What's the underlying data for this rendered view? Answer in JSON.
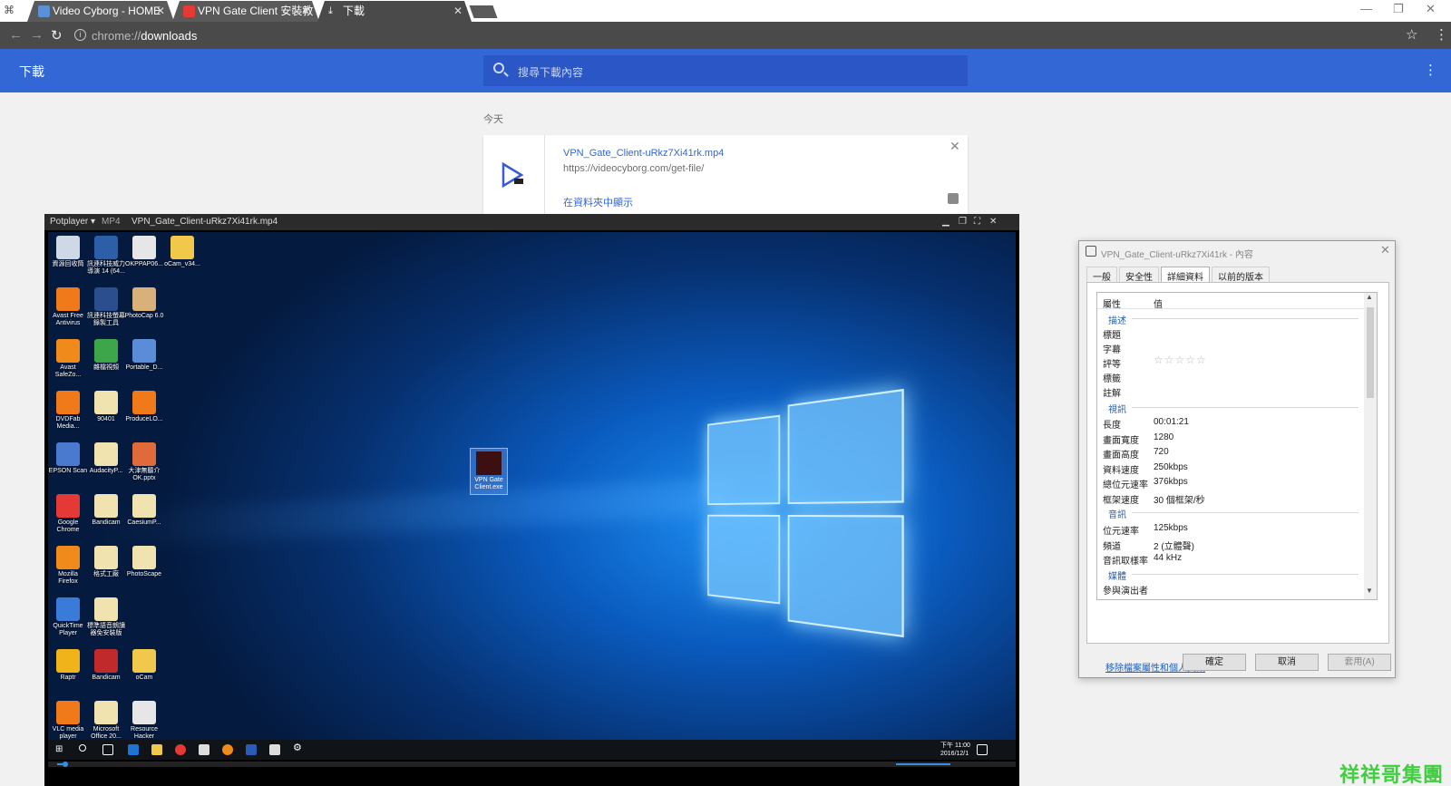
{
  "browser": {
    "tabs": [
      {
        "title": "Video Cyborg - HOME",
        "icon": "site-favicon",
        "icon_color": "#5b8fd6"
      },
      {
        "title": "VPN Gate Client 安裝教",
        "icon": "youtube-favicon",
        "icon_color": "#e53935"
      },
      {
        "title": "下載",
        "icon": "download-icon",
        "icon_color": "#ffffff"
      }
    ],
    "url_scheme": "chrome://",
    "url_path": "downloads"
  },
  "downloads": {
    "title": "下載",
    "search_placeholder": "搜尋下載內容",
    "group_label": "今天",
    "items": [
      {
        "filename": "VPN_Gate_Client-uRkz7Xi41rk.mp4",
        "source_url": "https://videocyborg.com/get-file/",
        "action": "在資料夾中顯示"
      }
    ]
  },
  "player": {
    "app": "Potplayer ▾",
    "format": "MP4",
    "file": "VPN_Gate_Client-uRkz7Xi41rk.mp4",
    "clock_time": "下午 11:00",
    "clock_date": "2016/12/1",
    "desktop_icons": [
      {
        "label": "資源回收筒",
        "color": "#cfd8e6"
      },
      {
        "label": "訊連科技威力導演 14 (64...",
        "color": "#2d5fa8"
      },
      {
        "label": "OKPPAP06...",
        "color": "#e6e6e6"
      },
      {
        "label": "oCam_v34...",
        "color": "#f2c84b"
      },
      {
        "label": "Avast Free Antivirus",
        "color": "#f07a1a"
      },
      {
        "label": "訊連科技螢幕錄製工具",
        "color": "#2b4e8e"
      },
      {
        "label": "PhotoCap 6.0",
        "color": "#d8b07a"
      },
      {
        "label": "Avast SafeZo...",
        "color": "#f08a1a"
      },
      {
        "label": "雜檔視頻",
        "color": "#3ea64a"
      },
      {
        "label": "Portable_D...",
        "color": "#5a8cd8"
      },
      {
        "label": "DVDFab Media...",
        "color": "#f07a1a"
      },
      {
        "label": "90401",
        "color": "#f1e3b0"
      },
      {
        "label": "ProduceLO...",
        "color": "#f07a1a"
      },
      {
        "label": "EPSON Scan",
        "color": "#4a7ad0"
      },
      {
        "label": "AudacityP...",
        "color": "#f1e3b0"
      },
      {
        "label": "大津無聽介OK.pptx",
        "color": "#e06a3a"
      },
      {
        "label": "Google Chrome",
        "color": "#e53935"
      },
      {
        "label": "Bandicam",
        "color": "#f1e3b0"
      },
      {
        "label": "CaesiumP...",
        "color": "#f1e3b0"
      },
      {
        "label": "Mozilla Firefox",
        "color": "#f08a1a"
      },
      {
        "label": "格式工廠",
        "color": "#f1e3b0"
      },
      {
        "label": "PhotoScape",
        "color": "#f1e3b0"
      },
      {
        "label": "QuickTime Player",
        "color": "#3a7ad8"
      },
      {
        "label": "標準語音朗讀器免安裝版",
        "color": "#f1e3b0"
      },
      {
        "label": "Raptr",
        "color": "#f0b41a"
      },
      {
        "label": "Bandicam",
        "color": "#c02a2a"
      },
      {
        "label": "oCam",
        "color": "#f0c84b"
      },
      {
        "label": "VLC media player",
        "color": "#f07a1a"
      },
      {
        "label": "Microsoft Office 20...",
        "color": "#f1e3b0"
      },
      {
        "label": "Resource Hacker",
        "color": "#e6e6e6"
      }
    ],
    "selected_file_label": "VPN Gate Client.exe"
  },
  "properties": {
    "title": "VPN_Gate_Client-uRkz7Xi41rk - 內容",
    "tabs": [
      "一般",
      "安全性",
      "詳細資料",
      "以前的版本"
    ],
    "active_tab": 2,
    "header_property": "屬性",
    "header_value": "值",
    "section_description": "描述",
    "row_title": "標題",
    "row_subtitle": "字幕",
    "row_rating": "評等",
    "rating_stars": "☆☆☆☆☆",
    "row_tags": "標籤",
    "row_comments": "註解",
    "section_video": "視訊",
    "video": [
      {
        "name": "長度",
        "value": "00:01:21"
      },
      {
        "name": "畫面寬度",
        "value": "1280"
      },
      {
        "name": "畫面高度",
        "value": "720"
      },
      {
        "name": "資料速度",
        "value": "250kbps"
      },
      {
        "name": "總位元速率",
        "value": "376kbps"
      },
      {
        "name": "框架速度",
        "value": "30 個框架/秒"
      }
    ],
    "section_audio": "音訊",
    "audio": [
      {
        "name": "位元速率",
        "value": "125kbps"
      },
      {
        "name": "頻道",
        "value": "2 (立體聲)"
      },
      {
        "name": "音訊取樣率",
        "value": "44 kHz"
      }
    ],
    "section_media": "媒體",
    "row_contributing": "參與演出者",
    "remove_link": "移除檔案屬性和個人資訊",
    "ok": "確定",
    "cancel": "取消",
    "apply": "套用(A)"
  },
  "watermark": "祥祥哥集團"
}
